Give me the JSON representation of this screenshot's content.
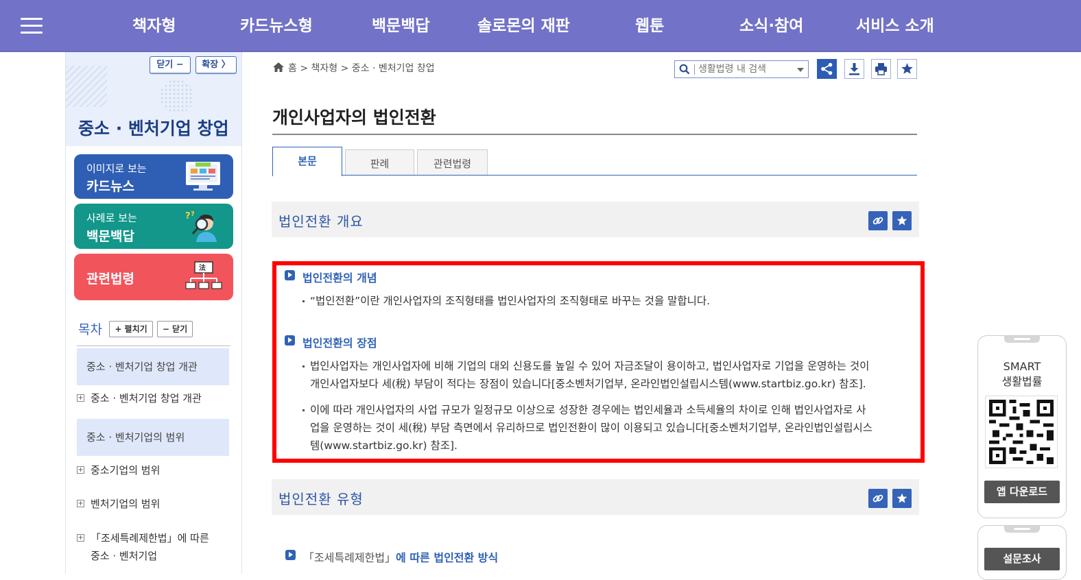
{
  "nav": {
    "items": [
      "책자형",
      "카드뉴스형",
      "백문백답",
      "솔로몬의 재판",
      "웹툰",
      "소식·참여",
      "서비스 소개"
    ]
  },
  "sidebar": {
    "close_btn": "닫기 −",
    "expand_btn": "확장 〉",
    "title": "중소 · 벤처기업 창업",
    "promos": [
      {
        "small": "이미지로 보는",
        "big": "카드뉴스",
        "color": "#2f5fb4"
      },
      {
        "small": "사례로 보는",
        "big": "백문백답",
        "color": "#12978a"
      },
      {
        "small": "",
        "big": "관련법령",
        "color": "#f2545b"
      }
    ],
    "toc_label": "목차",
    "toc_expand": "+ 펼치기",
    "toc_close": "− 닫기",
    "toc": {
      "hl1": "중소 · 벤처기업 창업 개관",
      "item1": "중소 · 벤처기업 창업 개관",
      "hl2": "중소 · 벤처기업의 범위",
      "item2": "중소기업의 범위",
      "item3": "벤처기업의 범위",
      "item4_line1": "「조세특례제한법」에 따른",
      "item4_line2": "중소 · 벤처기업"
    }
  },
  "breadcrumb": {
    "text": "홈 > 책자형 > 중소 · 벤처기업 창업"
  },
  "search": {
    "placeholder": "생활법령 내 검색"
  },
  "page": {
    "title": "개인사업자의 법인전환",
    "tabs": [
      "본문",
      "판례",
      "관련법령"
    ]
  },
  "sections": {
    "s1_title": "법인전환 개요",
    "s2_title": "법인전환 유형"
  },
  "content": {
    "h1": "법인전환의 개념",
    "p1": "“법인전환”이란 개인사업자의 조직형태를 법인사업자의 조직형태로 바꾸는 것을 말합니다.",
    "h2": "법인전환의 장점",
    "p2_line1": "법인사업자는 개인사업자에 비해 기업의 대외 신용도를 높일 수 있어 자금조달이 용이하고, 법인사업자로 기업을 운영하는 것이",
    "p2_line2": "개인사업자보다 세(稅) 부담이 적다는 장점이 있습니다[중소벤처기업부, 온라인법인설립시스템(www.startbiz.go.kr) 참조].",
    "p3_line1": "이에 따라 개인사업자의 사업 규모가 일정규모 이상으로 성장한 경우에는 법인세율과 소득세율의 차이로 인해 법인사업자로 사",
    "p3_line2": "업을 운영하는 것이 세(稅) 부담 측면에서 유리하므로 법인전환이 많이 이용되고 있습니다[중소벤처기업부, 온라인법인설립시스",
    "p3_line3": "템(www.startbiz.go.kr) 참조].",
    "bottom_a": "「조세특례제한법」",
    "bottom_b": "에 따른 법인전환 방식"
  },
  "side_widget": {
    "title_line1": "SMART",
    "title_line2": "생활법률",
    "app_btn": "앱 다운로드",
    "survey_btn": "설문조사"
  },
  "colors": {
    "nav": "#7272c8",
    "accent": "#2f62b6",
    "highlight_border": "#ff0000"
  }
}
